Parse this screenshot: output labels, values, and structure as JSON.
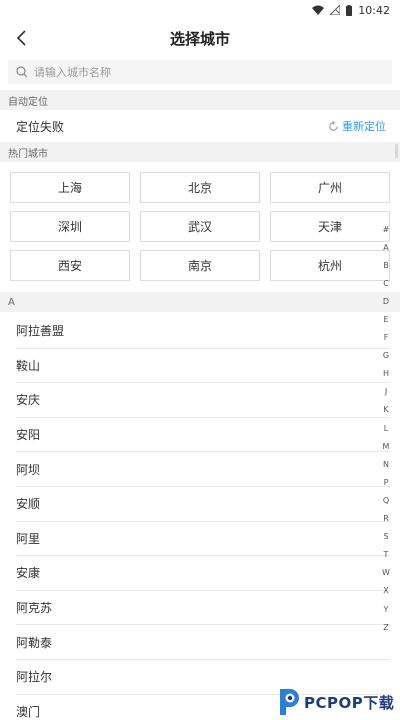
{
  "status_bar": {
    "time": "10:42"
  },
  "nav": {
    "title": "选择城市"
  },
  "search": {
    "placeholder": "请输入城市名称"
  },
  "sections": {
    "auto_locate": "自动定位",
    "hot_cities": "热门城市",
    "letter_a": "A"
  },
  "locate": {
    "status": "定位失败",
    "relocate_label": "重新定位"
  },
  "hot_cities": [
    "上海",
    "北京",
    "广州",
    "深圳",
    "武汉",
    "天津",
    "西安",
    "南京",
    "杭州"
  ],
  "cities_a": [
    "阿拉善盟",
    "鞍山",
    "安庆",
    "安阳",
    "阿坝",
    "安顺",
    "阿里",
    "安康",
    "阿克苏",
    "阿勒泰",
    "阿拉尔",
    "澳门"
  ],
  "index_letters": [
    "#",
    "A",
    "B",
    "C",
    "D",
    "E",
    "F",
    "G",
    "H",
    "J",
    "K",
    "L",
    "M",
    "N",
    "P",
    "Q",
    "R",
    "S",
    "T",
    "W",
    "X",
    "Y",
    "Z"
  ],
  "watermark": {
    "text": "PCPOP下载"
  },
  "colors": {
    "accent": "#2b9fe6",
    "section_bg": "#f2f2f2",
    "search_bg": "#f5f5f5"
  },
  "icons": {
    "back": "arrow-left-icon",
    "search": "search-icon",
    "refresh": "refresh-icon",
    "wifi": "wifi-icon",
    "signal": "no-signal-icon",
    "battery": "battery-icon"
  }
}
